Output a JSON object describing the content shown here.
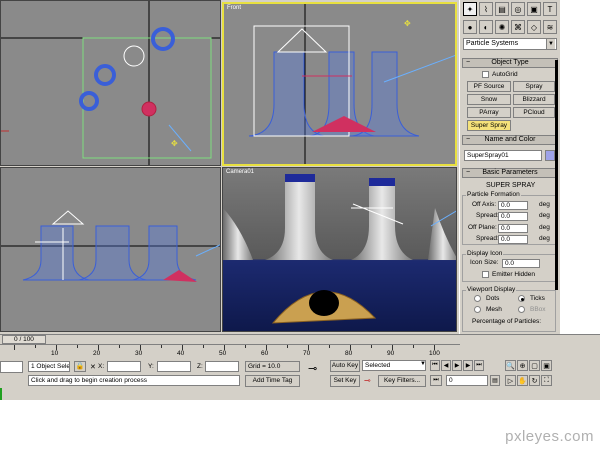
{
  "viewports": {
    "front_label": "Front",
    "camera_label": "Camera01"
  },
  "command_panel": {
    "category": "Particle Systems",
    "object_type": {
      "title": "Object Type",
      "autogrid": "AutoGrid",
      "buttons": [
        "PF Source",
        "Spray",
        "Snow",
        "Blizzard",
        "PArray",
        "PCloud",
        "Super Spray"
      ]
    },
    "name_color": {
      "title": "Name and Color",
      "name_value": "SuperSpray01",
      "color": "#9ea2e8"
    },
    "basic_params": {
      "title": "Basic Parameters",
      "heading": "SUPER SPRAY",
      "particle_formation": "Particle Formation",
      "off_axis": "Off Axis:",
      "off_axis_value": "0.0",
      "spread1": "Spread:",
      "spread1_value": "0.0",
      "off_plane": "Off Plane:",
      "off_plane_value": "0.0",
      "spread2": "Spread:",
      "spread2_value": "0.0",
      "unit": "deg",
      "display_icon": "Display Icon",
      "icon_size": "Icon Size:",
      "icon_size_value": "0.0",
      "emitter_hidden": "Emitter Hidden",
      "viewport_display": "Viewport Display",
      "dots": "Dots",
      "ticks": "Ticks",
      "mesh": "Mesh",
      "bbox": "BBox",
      "pct_particles": "Percentage of Particles:"
    }
  },
  "timeline": {
    "frame": "0 / 100",
    "ticks": [
      "10",
      "20",
      "30",
      "40",
      "50",
      "60",
      "70",
      "80",
      "90",
      "100"
    ]
  },
  "status": {
    "selection": "1 Object Sele",
    "x_label": "X:",
    "y_label": "Y:",
    "z_label": "Z:",
    "grid": "Grid = 10.0",
    "prompt": "Click and drag to begin creation process",
    "add_time_tag": "Add Time Tag",
    "auto_key": "Auto Key",
    "set_key": "Set Key",
    "selected": "Selected",
    "key_filters": "Key Filters...",
    "frame_value": "0"
  },
  "colors": {
    "viewport_bg": "#8a8a8a",
    "active_border": "#e8e040",
    "panel_bg": "#d4d0c8",
    "wireframe": "#3a5fd8",
    "emitter": "#d03060"
  },
  "watermark": "pxleyes.com"
}
